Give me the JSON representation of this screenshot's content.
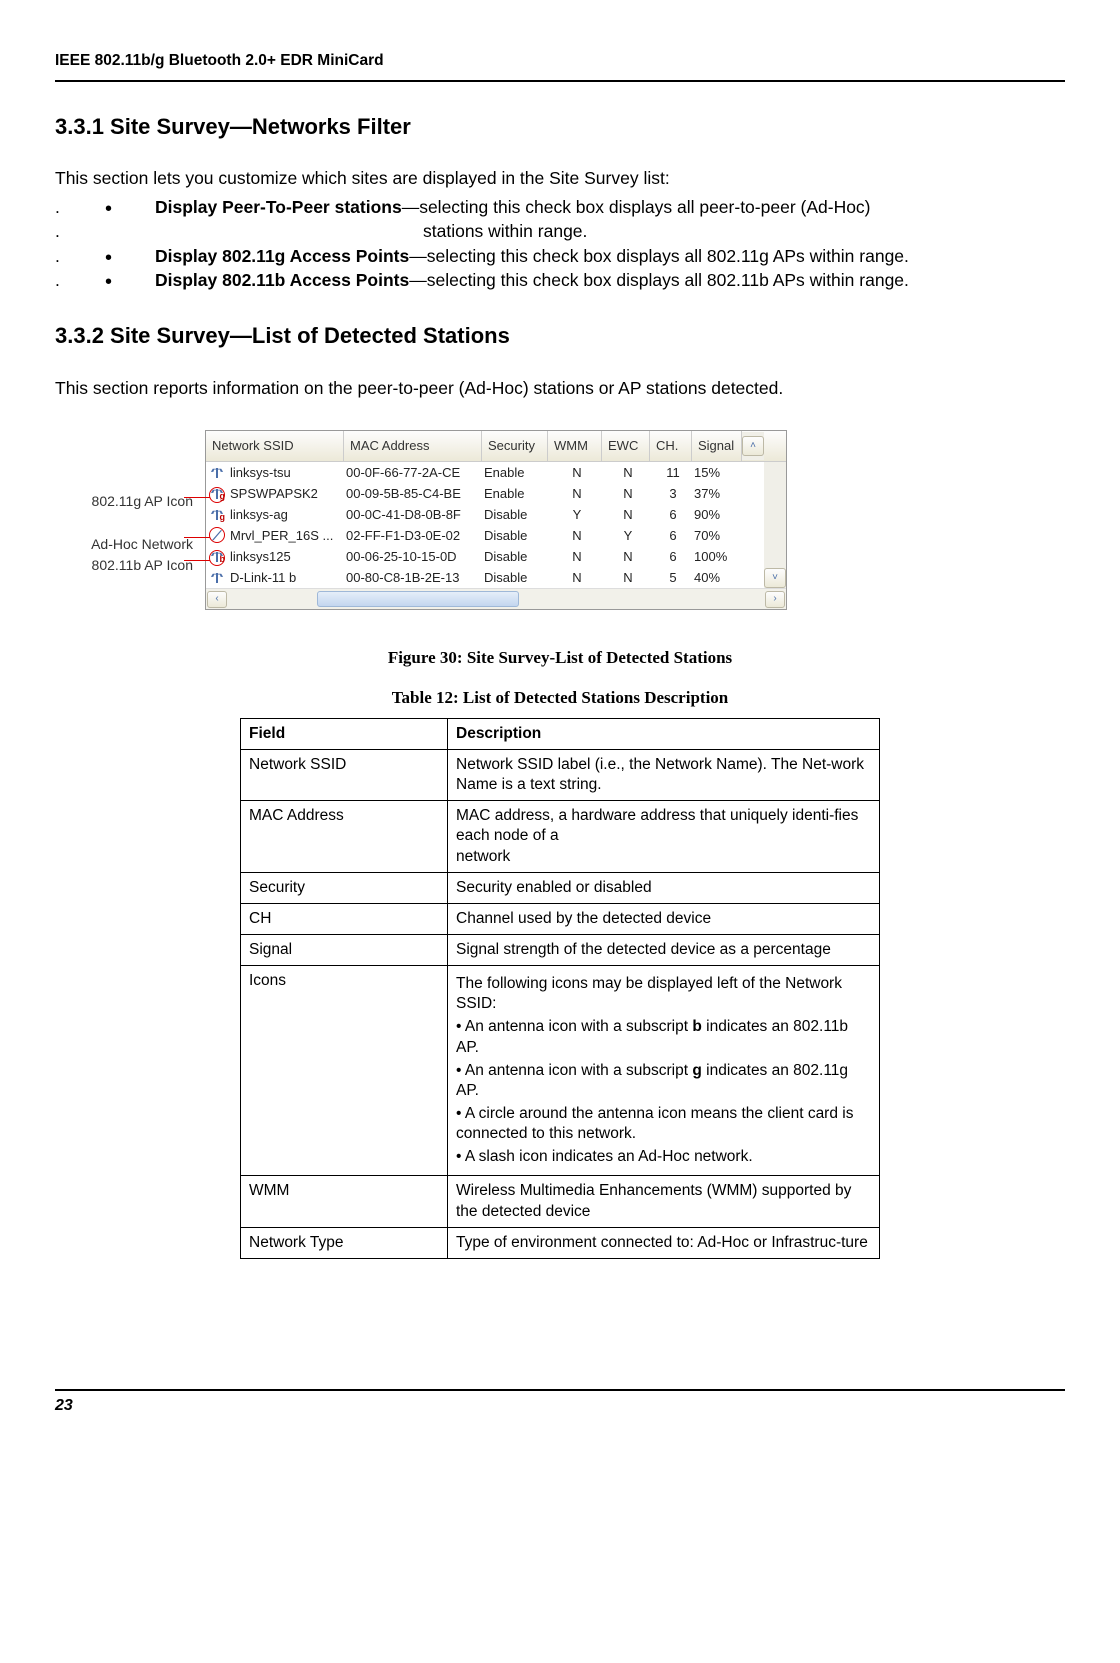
{
  "header": "IEEE 802.11b/g Bluetooth 2.0+ EDR MiniCard",
  "section331": {
    "title": "3.3.1 Site Survey—Networks Filter",
    "intro": "This section lets you customize which sites are displayed in the Site Survey list:",
    "b1_bold": "Display Peer-To-Peer stations",
    "b1_rest": "—selecting this check box displays all peer-to-peer (Ad-Hoc)",
    "b1_line2": "stations within range.",
    "b2_bold": "Display 802.11g Access Points",
    "b2_rest": "—selecting this check box displays all 802.11g APs within range.",
    "b3_bold": "Display 802.11b Access Points",
    "b3_rest": "—selecting this check box displays all 802.11b APs within range."
  },
  "section332": {
    "title": "3.3.2 Site Survey—List of Detected Stations",
    "intro": "This section reports information on the peer-to-peer (Ad-Hoc) stations or AP stations detected."
  },
  "callouts": {
    "g": "802.11g AP Icon",
    "adhoc": "Ad-Hoc Network",
    "b": "802.11b AP Icon"
  },
  "win": {
    "columns": {
      "ssid": "Network SSID",
      "mac": "MAC Address",
      "sec": "Security",
      "wmm": "WMM",
      "ewc": "EWC",
      "ch": "CH.",
      "sig": "Signal"
    },
    "rows": [
      {
        "ssid": "linksys-tsu",
        "mac": "00-0F-66-77-2A-CE",
        "sec": "Enable",
        "wmm": "N",
        "ewc": "N",
        "ch": "11",
        "sig": "15%"
      },
      {
        "ssid": "SPSWPAPSK2",
        "mac": "00-09-5B-85-C4-BE",
        "sec": "Enable",
        "wmm": "N",
        "ewc": "N",
        "ch": "3",
        "sig": "37%"
      },
      {
        "ssid": "linksys-ag",
        "mac": "00-0C-41-D8-0B-8F",
        "sec": "Disable",
        "wmm": "Y",
        "ewc": "N",
        "ch": "6",
        "sig": "90%"
      },
      {
        "ssid": "Mrvl_PER_16S ...",
        "mac": "02-FF-F1-D3-0E-02",
        "sec": "Disable",
        "wmm": "N",
        "ewc": "Y",
        "ch": "6",
        "sig": "70%"
      },
      {
        "ssid": "linksys125",
        "mac": "00-06-25-10-15-0D",
        "sec": "Disable",
        "wmm": "N",
        "ewc": "N",
        "ch": "6",
        "sig": "100%"
      },
      {
        "ssid": "D-Link-11 b",
        "mac": "00-80-C8-1B-2E-13",
        "sec": "Disable",
        "wmm": "N",
        "ewc": "N",
        "ch": "5",
        "sig": "40%"
      }
    ]
  },
  "figure_caption": "Figure 30: Site Survey-List of Detected Stations",
  "table_caption": "Table 12: List of Detected Stations Description",
  "table": {
    "h1": "Field",
    "h2": "Description",
    "rows": {
      "ssid_f": "Network SSID",
      "ssid_d": "Network SSID label (i.e., the Network Name). The Net-work Name is a text string.",
      "mac_f": "MAC Address",
      "mac_d": "MAC address, a hardware address that uniquely identi-fies each node of a\nnetwork",
      "sec_f": "Security",
      "sec_d": "Security enabled or disabled",
      "ch_f": "CH",
      "ch_d": "Channel used by the detected device",
      "sig_f": "Signal",
      "sig_d": "Signal strength of the detected device as a percentage",
      "icons_f": "Icons",
      "icons_intro": "The following icons may be displayed left of the Network SSID:",
      "icons_b1_pre": "• An antenna icon with a subscript ",
      "icons_b1_bold": "b",
      "icons_b1_post": " indicates an 802.11b AP.",
      "icons_b2_pre": "• An antenna icon with a subscript ",
      "icons_b2_bold": "g",
      "icons_b2_post": " indicates an 802.11g AP.",
      "icons_b3": "• A circle around the antenna icon means the client card is connected to this network.",
      "icons_b4": "• A slash icon indicates an Ad-Hoc network.",
      "wmm_f": "WMM",
      "wmm_d": "Wireless Multimedia Enhancements (WMM) supported by the detected device",
      "nt_f": "Network Type",
      "nt_d": "Type of environment connected to: Ad-Hoc or Infrastruc-ture"
    }
  },
  "page_number": "23"
}
